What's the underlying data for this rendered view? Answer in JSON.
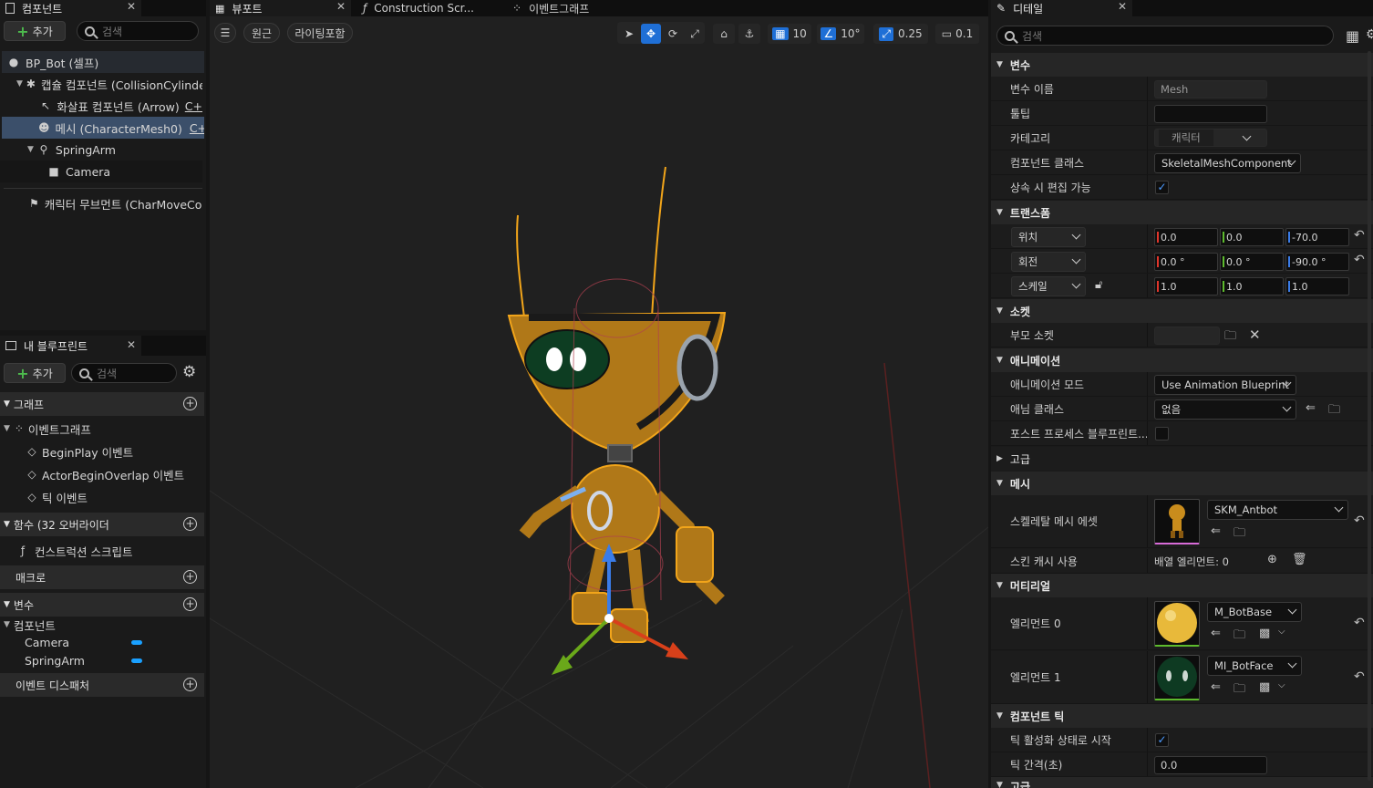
{
  "components_panel": {
    "tab_label": "컴포넌트",
    "add_label": "추가",
    "search_placeholder": "검색",
    "tree": [
      {
        "label": "BP_Bot (셀프)"
      },
      {
        "label": "캡슐 컴포넌트 (CollisionCylinder)"
      },
      {
        "label": "화살표 컴포넌트 (Arrow)",
        "suffix": "C+"
      },
      {
        "label": "메시 (CharacterMesh0)",
        "suffix": "C+"
      },
      {
        "label": "SpringArm"
      },
      {
        "label": "Camera"
      },
      {
        "label": "캐릭터 무브먼트 (CharMoveComp)"
      }
    ]
  },
  "blueprint_panel": {
    "tab_label": "내 블루프린트",
    "add_label": "추가",
    "search_placeholder": "검색",
    "graph_section": "그래프",
    "event_graph": "이벤트그래프",
    "events": [
      "BeginPlay 이벤트",
      "ActorBeginOverlap 이벤트",
      "틱 이벤트"
    ],
    "functions_section": "함수 (32 오버라이더",
    "construction_script": "컨스트럭션 스크립트",
    "macros_section": "매크로",
    "variables_section": "변수",
    "components_group": "컴포넌트",
    "variables": [
      {
        "name": "Camera",
        "color": "#1aa0ff"
      },
      {
        "name": "SpringArm",
        "color": "#1aa0ff"
      }
    ],
    "event_dispatchers": "이벤트 디스패처"
  },
  "viewport": {
    "tabs": [
      "뷰포트",
      "Construction Scr...",
      "이벤트그래프"
    ],
    "perspective_label": "원근",
    "lighting_label": "라이팅포함",
    "grid_snap": "10",
    "rotation_snap": "10°",
    "scale_snap": "0.25",
    "camera_speed": "0.1"
  },
  "details_panel": {
    "tab_label": "디테일",
    "search_placeholder": "검색",
    "sections": {
      "variable": "변수",
      "transform": "트랜스폼",
      "sockets": "소켓",
      "animation": "애니메이션",
      "advanced": "고급",
      "mesh": "메시",
      "materials": "머티리얼",
      "component_tick": "컴포넌트 틱",
      "cut_off": "고급"
    },
    "variable_name_label": "변수 이름",
    "variable_name_value": "Mesh",
    "tooltip_label": "툴팁",
    "category_label": "카테고리",
    "category_value": "캐릭터",
    "component_class_label": "컴포넌트 클래스",
    "component_class_value": "SkeletalMeshComponent",
    "editable_when_inherited_label": "상속 시 편집 가능",
    "location_label": "위치",
    "location": [
      "0.0",
      "0.0",
      "-70.0"
    ],
    "rotation_label": "회전",
    "rotation": [
      "0.0 °",
      "0.0 °",
      "-90.0 °"
    ],
    "scale_label": "스케일",
    "scale": [
      "1.0",
      "1.0",
      "1.0"
    ],
    "parent_socket_label": "부모 소켓",
    "animation_mode_label": "애니메이션 모드",
    "animation_mode_value": "Use Animation Blueprint",
    "anim_class_label": "애님 클래스",
    "anim_class_value": "없음",
    "post_process_label": "포스트 프로세스 블루프린트...",
    "skeletal_mesh_asset_label": "스켈레탈 메시 에셋",
    "skeletal_mesh_value": "SKM_Antbot",
    "skin_cache_label": "스킨 캐시 사용",
    "array_elements_text": "배열 엘리먼트: 0",
    "element0_label": "엘리먼트 0",
    "element0_value": "M_BotBase",
    "element1_label": "엘리먼트 1",
    "element1_value": "MI_BotFace",
    "start_with_tick_label": "틱 활성화 상태로 시작",
    "tick_interval_label": "틱 간격(초)",
    "tick_interval_value": "0.0"
  }
}
